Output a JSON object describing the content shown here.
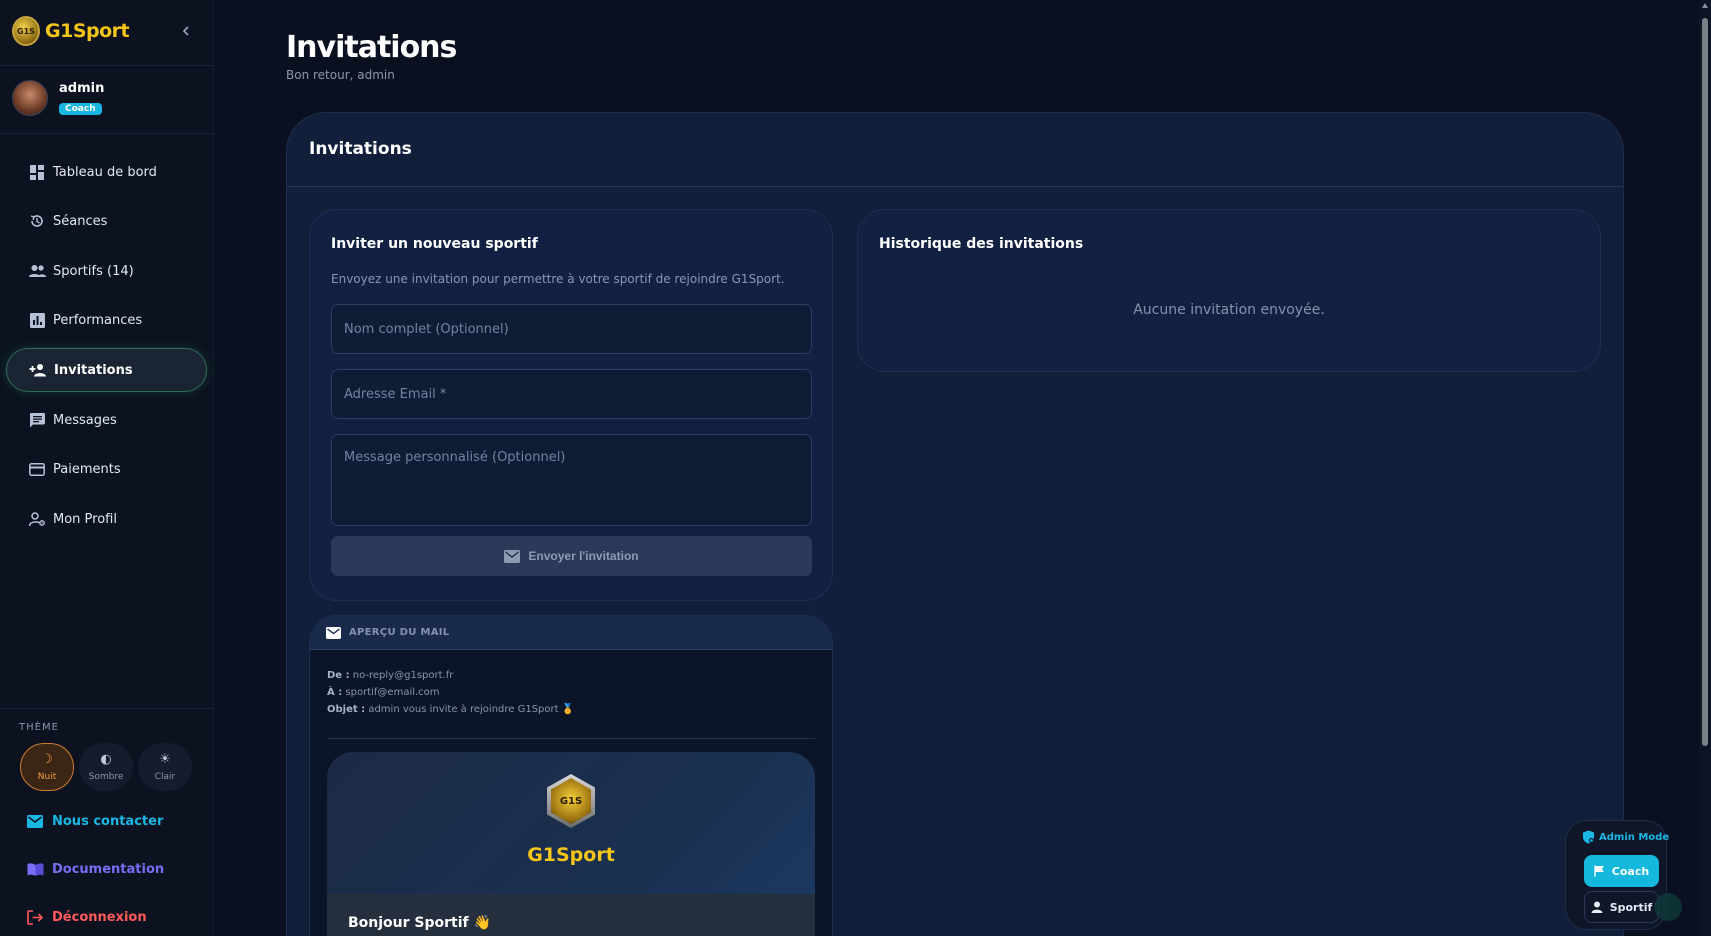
{
  "brand": {
    "name": "G1Sport",
    "logo_text": "G1S"
  },
  "user": {
    "name": "admin",
    "role_badge": "Coach"
  },
  "nav": [
    {
      "label": "Tableau de bord",
      "icon": "dashboard-icon"
    },
    {
      "label": "Séances",
      "icon": "history-icon"
    },
    {
      "label": "Sportifs (14)",
      "icon": "people-icon"
    },
    {
      "label": "Performances",
      "icon": "bar-chart-icon"
    },
    {
      "label": "Invitations",
      "icon": "person-add-icon",
      "active": true
    },
    {
      "label": "Messages",
      "icon": "chat-icon"
    },
    {
      "label": "Paiements",
      "icon": "credit-card-icon"
    },
    {
      "label": "Mon Profil",
      "icon": "person-settings-icon"
    }
  ],
  "theme": {
    "label": "THÈME",
    "options": [
      {
        "label": "Nuit",
        "icon": "moon-icon",
        "active": true
      },
      {
        "label": "Sombre",
        "icon": "contrast-icon"
      },
      {
        "label": "Clair",
        "icon": "sun-icon"
      }
    ]
  },
  "links": {
    "contact": "Nous contacter",
    "docs": "Documentation",
    "logout": "Déconnexion"
  },
  "page": {
    "title": "Invitations",
    "subtitle": "Bon retour, admin"
  },
  "card": {
    "title": "Invitations"
  },
  "invite_form": {
    "title": "Inviter un nouveau sportif",
    "description": "Envoyez une invitation pour permettre à votre sportif de rejoindre G1Sport.",
    "name_placeholder": "Nom complet (Optionnel)",
    "email_placeholder": "Adresse Email *",
    "message_placeholder": "Message personnalisé (Optionnel)",
    "send_label": "Envoyer l'invitation"
  },
  "history": {
    "title": "Historique des invitations",
    "empty": "Aucune invitation envoyée."
  },
  "preview": {
    "header": "APERÇU DU MAIL",
    "from_label": "De :",
    "from": "no-reply@g1sport.fr",
    "to_label": "À :",
    "to": "sportif@email.com",
    "subject_label": "Objet :",
    "subject": "admin vous invite à rejoindre G1Sport 🏅",
    "brand": "G1Sport",
    "logo_text": "G1S",
    "greeting": "Bonjour Sportif 👋"
  },
  "admin_widget": {
    "label": "Admin Mode",
    "coach": "Coach",
    "sportif": "Sportif"
  },
  "colors": {
    "accent": "#f5c518",
    "cyan": "#14b8dc",
    "active_theme": "#f59b3a",
    "logout": "#ff5a5a",
    "docs": "#7a6cf5"
  }
}
